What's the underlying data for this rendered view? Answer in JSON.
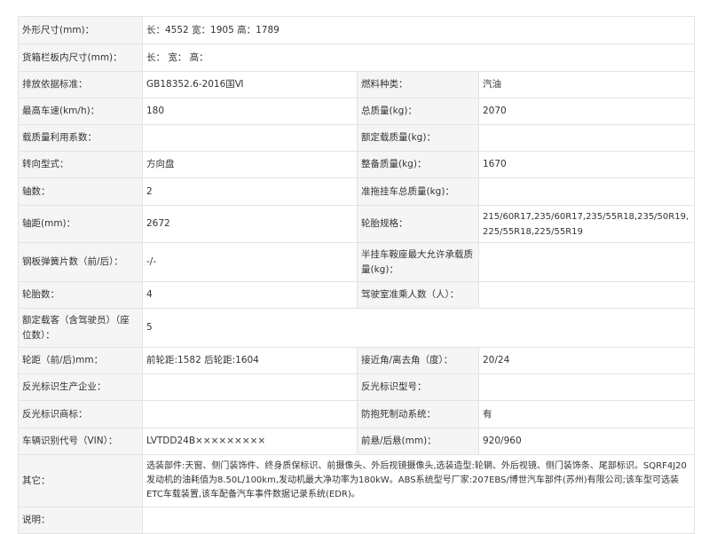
{
  "rows": [
    {
      "label": "外形尺寸(mm)：",
      "value": "长：4552 宽：1905 高：1789"
    },
    {
      "label": "货箱栏板内尺寸(mm)：",
      "value": "长：  宽：  高："
    },
    {
      "label": "排放依据标准：",
      "value": "GB18352.6-2016国Ⅵ",
      "label2": "燃料种类：",
      "value2": "汽油"
    },
    {
      "label": "最高车速(km/h)：",
      "value": "180",
      "label2": "总质量(kg)：",
      "value2": "2070"
    },
    {
      "label": "载质量利用系数：",
      "value": "",
      "label2": "额定载质量(kg)：",
      "value2": ""
    },
    {
      "label": "转向型式：",
      "value": "方向盘",
      "label2": "整备质量(kg)：",
      "value2": "1670"
    },
    {
      "label": "轴数：",
      "value": "2",
      "label2": "准拖挂车总质量(kg)：",
      "value2": ""
    },
    {
      "label": "轴距(mm)：",
      "value": "2672",
      "label2": "轮胎规格：",
      "value2": "215/60R17,235/60R17,235/55R18,235/50R19,225/55R18,225/55R19"
    },
    {
      "label": "钢板弹簧片数（前/后）：",
      "value": "-/-",
      "label2": "半挂车鞍座最大允许承载质量(kg)：",
      "value2": ""
    },
    {
      "label": "轮胎数：",
      "value": "4",
      "label2": "驾驶室准乘人数（人）：",
      "value2": ""
    },
    {
      "label": "额定载客（含驾驶员）（座位数）：",
      "value": "5"
    },
    {
      "label": "轮距（前/后)mm：",
      "value": "前轮距:1582 后轮距:1604",
      "label2": "接近角/离去角（度）：",
      "value2": "20/24"
    },
    {
      "label": "反光标识生产企业：",
      "value": "",
      "label2": "反光标识型号：",
      "value2": ""
    },
    {
      "label": "反光标识商标：",
      "value": "",
      "label2": "防抱死制动系统：",
      "value2": "有"
    },
    {
      "label": "车辆识别代号（VIN）：",
      "value": "LVTDD24B×××××××××",
      "label2": "前悬/后悬(mm)：",
      "value2": "920/960"
    },
    {
      "label": "其它：",
      "value": "选装部件:天窗、侧门装饰件、终身质保标识、前摄像头、外后视镜摄像头,选装造型:轮辋、外后视镜、侧门装饰条、尾部标识。SQRF4J20发动机的油耗值为8.50L/100km,发动机最大净功率为180kW。ABS系统型号厂家:207EBS/博世汽车部件(苏州)有限公司;该车型可选装ETC车载装置,该车配备汽车事件数据记录系统(EDR)。"
    },
    {
      "label": "说明：",
      "value": ""
    }
  ]
}
